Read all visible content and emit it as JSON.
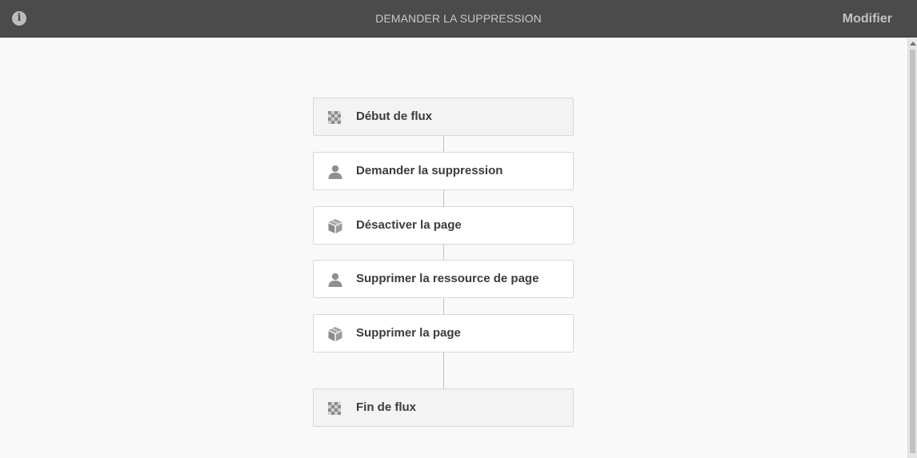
{
  "header": {
    "title": "DEMANDER LA SUPPRESSION",
    "edit_label": "Modifier",
    "info_icon": "info-icon"
  },
  "workflow": {
    "steps": [
      {
        "label": "Début de flux",
        "icon": "flag-checkered-icon",
        "kind": "flow"
      },
      {
        "label": "Demander la suppression",
        "icon": "user-icon",
        "kind": "participant"
      },
      {
        "label": "Désactiver la page",
        "icon": "cube-process-icon",
        "kind": "process"
      },
      {
        "label": "Supprimer la ressource de page",
        "icon": "user-icon",
        "kind": "participant"
      },
      {
        "label": "Supprimer la page",
        "icon": "cube-process-icon",
        "kind": "process"
      },
      {
        "label": "Fin de flux",
        "icon": "flag-checkered-icon",
        "kind": "flow"
      }
    ]
  }
}
